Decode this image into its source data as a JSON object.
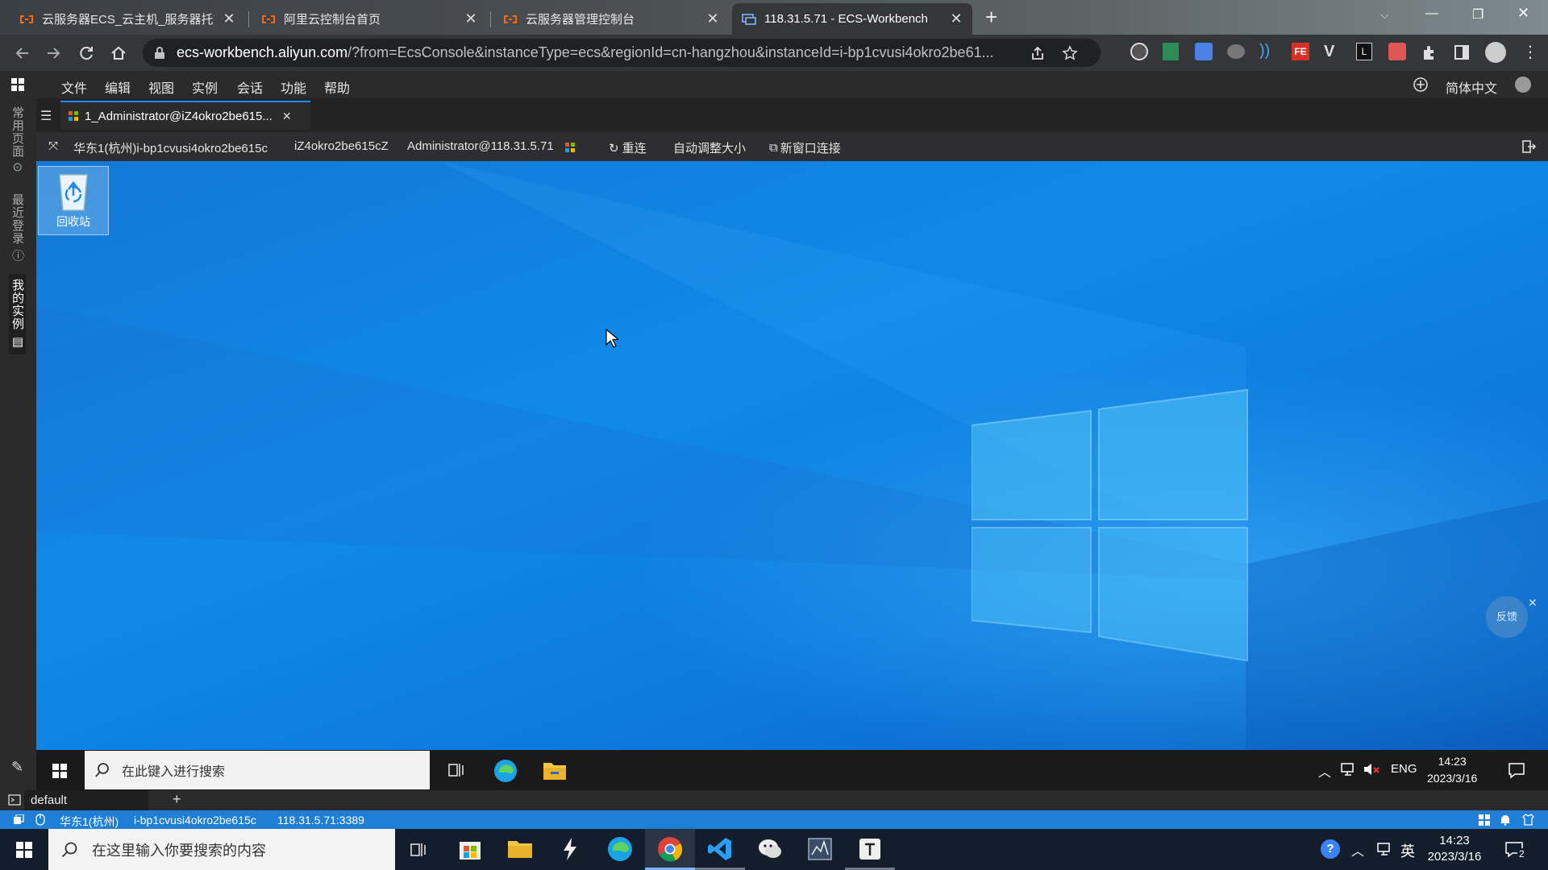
{
  "browser": {
    "tabs": [
      {
        "title": "云服务器ECS_云主机_服务器托管",
        "favicon": "aliyun-logo"
      },
      {
        "title": "阿里云控制台首页",
        "favicon": "aliyun-logo"
      },
      {
        "title": "云服务器管理控制台",
        "favicon": "aliyun-logo"
      },
      {
        "title": "118.31.5.71 - ECS-Workbench",
        "favicon": "remote-desktop"
      }
    ],
    "new_tab": "+",
    "url_domain": "ecs-workbench.aliyun.com",
    "url_rest": "/?from=EcsConsole&instanceType=ecs&regionId=cn-hangzhou&instanceId=i-bp1cvusi4okro2be61..."
  },
  "workbench": {
    "menu": [
      "文件",
      "编辑",
      "视图",
      "实例",
      "会话",
      "功能",
      "帮助"
    ],
    "language": "简体中文",
    "sidebar_tabs": [
      "常用页面",
      "最近登录",
      "我的实例"
    ],
    "session_tab": "1_Administrator@iZ4okro2be615...",
    "info": {
      "region_instance": "华东1(杭州)i-bp1cvusi4okro2be615c",
      "hostname": "iZ4okro2be615cZ",
      "user": "Administrator@118.31.5.71",
      "reconnect": "重连",
      "auto_resize": "自动调整大小",
      "new_window": "新窗口连接"
    },
    "terminal_tab": "default",
    "status": {
      "region": "华东1(杭州)",
      "instance": "i-bp1cvusi4okro2be615c",
      "address": "118.31.5.71:3389"
    },
    "feedback": "反馈"
  },
  "remote_desktop": {
    "recycle_bin": "回收站",
    "search_placeholder": "在此键入进行搜索",
    "ime": "ENG",
    "time": "14:23",
    "date": "2023/3/16"
  },
  "host_taskbar": {
    "search_placeholder": "在这里输入你要搜索的内容",
    "ime": "英",
    "time": "14:23",
    "date": "2023/3/16",
    "notification_count": "2"
  },
  "colors": {
    "accent": "#1f7ed6",
    "desktop": "#0f8ae8",
    "aliyun_orange": "#ff6a00"
  }
}
